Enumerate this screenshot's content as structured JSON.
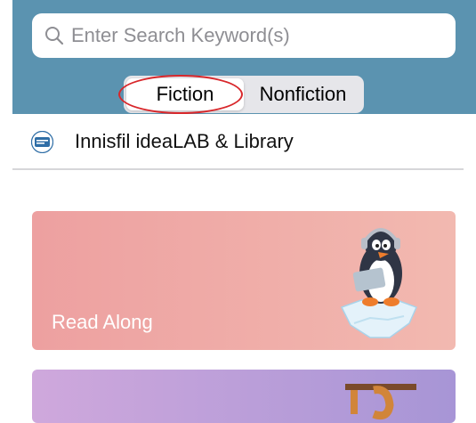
{
  "search": {
    "placeholder": "Enter Search Keyword(s)",
    "icon": "search-icon"
  },
  "tabs": [
    {
      "label": "Fiction",
      "selected": true
    },
    {
      "label": "Nonfiction",
      "selected": false
    }
  ],
  "library": {
    "name": "Innisfil ideaLAB & Library",
    "logo_text": "ideaLAB & Library"
  },
  "cards": [
    {
      "title": "Read Along",
      "color_start": "#eda0a0",
      "color_end": "#f2b9b0"
    },
    {
      "title": "",
      "color_start": "#cfa8dc",
      "color_end": "#a795d6"
    }
  ],
  "colors": {
    "header": "#5b93b0",
    "annotation": "#d8262a"
  }
}
